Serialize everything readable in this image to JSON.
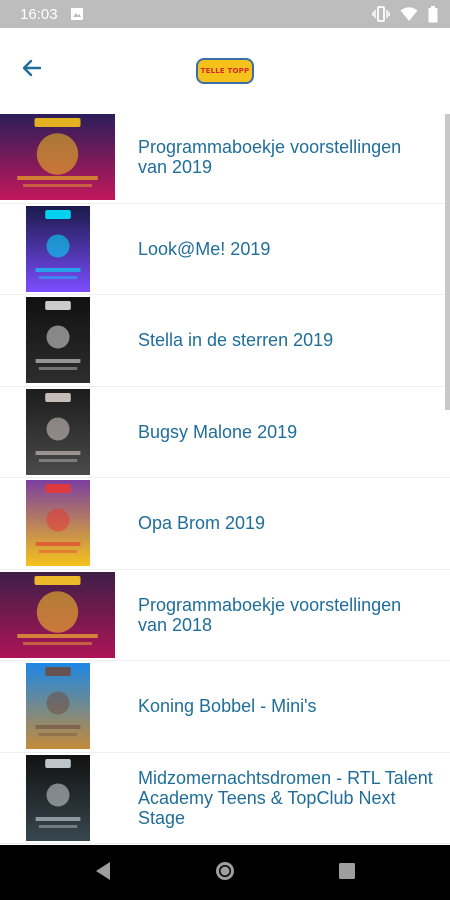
{
  "status_bar": {
    "time": "16:03",
    "icons": [
      "image-notification-icon",
      "vibrate-icon",
      "wifi-icon",
      "battery-icon"
    ]
  },
  "app_bar": {
    "back_icon": "back-arrow-icon",
    "logo_text": "TELLE TOPP"
  },
  "list": {
    "items": [
      {
        "label": "Programmaboekje voorstellingen\nvan 2019",
        "thumb": "wide",
        "colors": [
          "#2b1e5a",
          "#c2185b",
          "#f5c21b"
        ]
      },
      {
        "label": "Look@Me! 2019",
        "thumb": "tall",
        "colors": [
          "#1a1a4a",
          "#7c4dff",
          "#00e5ff"
        ]
      },
      {
        "label": "Stella in de sterren 2019",
        "thumb": "tall",
        "colors": [
          "#111111",
          "#2d2d2d",
          "#e0e0e0"
        ]
      },
      {
        "label": "Bugsy Malone 2019",
        "thumb": "tall",
        "colors": [
          "#1c1c1c",
          "#4a4a4a",
          "#d7ccc8"
        ]
      },
      {
        "label": "Opa Brom 2019",
        "thumb": "tall",
        "colors": [
          "#7b3fa0",
          "#f5c21b",
          "#e53935"
        ]
      },
      {
        "label": "Programmaboekje voorstellingen\nvan 2018",
        "thumb": "wide",
        "colors": [
          "#3e1f47",
          "#ad1457",
          "#ffca28"
        ]
      },
      {
        "label": "Koning Bobbel - Mini's",
        "thumb": "tall",
        "colors": [
          "#1e88e5",
          "#c58b3a",
          "#6d4c41"
        ]
      },
      {
        "label": "Midzomernachtsdromen - RTL Talent\nAcademy Teens & TopClub Next\nStage",
        "thumb": "tall",
        "colors": [
          "#121212",
          "#37474f",
          "#cfd8dc"
        ]
      }
    ]
  },
  "nav_bar": {
    "icons": [
      "back-triangle-icon",
      "home-circle-icon",
      "recents-square-icon"
    ]
  }
}
